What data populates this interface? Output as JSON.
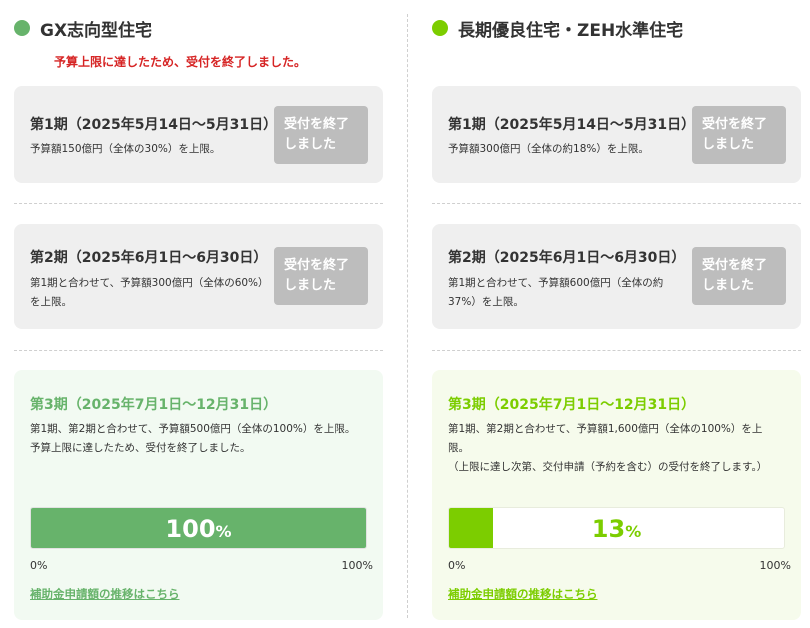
{
  "colors": {
    "gx_green": "#67b36b",
    "zeh_green": "#7ccd00",
    "closed_gray": "#bdbdbd",
    "notice_red": "#d62424"
  },
  "left": {
    "title": "GX志向型住宅",
    "notice": "予算上限に達したため、受付を終了しました。",
    "period1": {
      "title": "第1期（2025年5月14日〜5月31日）",
      "desc": "予算額150億円（全体の30%）を上限。",
      "status": "受付を終了しました"
    },
    "period2": {
      "title": "第2期（2025年6月1日〜6月30日）",
      "desc": "第1期と合わせて、予算額300億円（全体の60%）を上限。",
      "status": "受付を終了しました"
    },
    "period3": {
      "title": "第3期（2025年7月1日〜12月31日）",
      "desc1": "第1期、第2期と合わせて、予算額500億円（全体の100%）を上限。",
      "desc2": "予算上限に達したため、受付を終了しました。",
      "progress_value": "100",
      "progress_unit": "%",
      "progress_fraction": 1.0,
      "min_label": "0%",
      "max_label": "100%",
      "link": "補助金申請額の推移はこちら"
    }
  },
  "right": {
    "title": "長期優良住宅・ZEH水準住宅",
    "period1": {
      "title": "第1期（2025年5月14日〜5月31日）",
      "desc": "予算額300億円（全体の約18%）を上限。",
      "status": "受付を終了しました"
    },
    "period2": {
      "title": "第2期（2025年6月1日〜6月30日）",
      "desc": "第1期と合わせて、予算額600億円（全体の約37%）を上限。",
      "status": "受付を終了しました"
    },
    "period3": {
      "title": "第3期（2025年7月1日〜12月31日）",
      "desc1": "第1期、第2期と合わせて、予算額1,600億円（全体の100%）を上限。",
      "desc2": "（上限に達し次第、交付申請（予約を含む）の受付を終了します。）",
      "progress_value": "13",
      "progress_unit": "%",
      "progress_fraction": 0.13,
      "min_label": "0%",
      "max_label": "100%",
      "link": "補助金申請額の推移はこちら"
    }
  }
}
